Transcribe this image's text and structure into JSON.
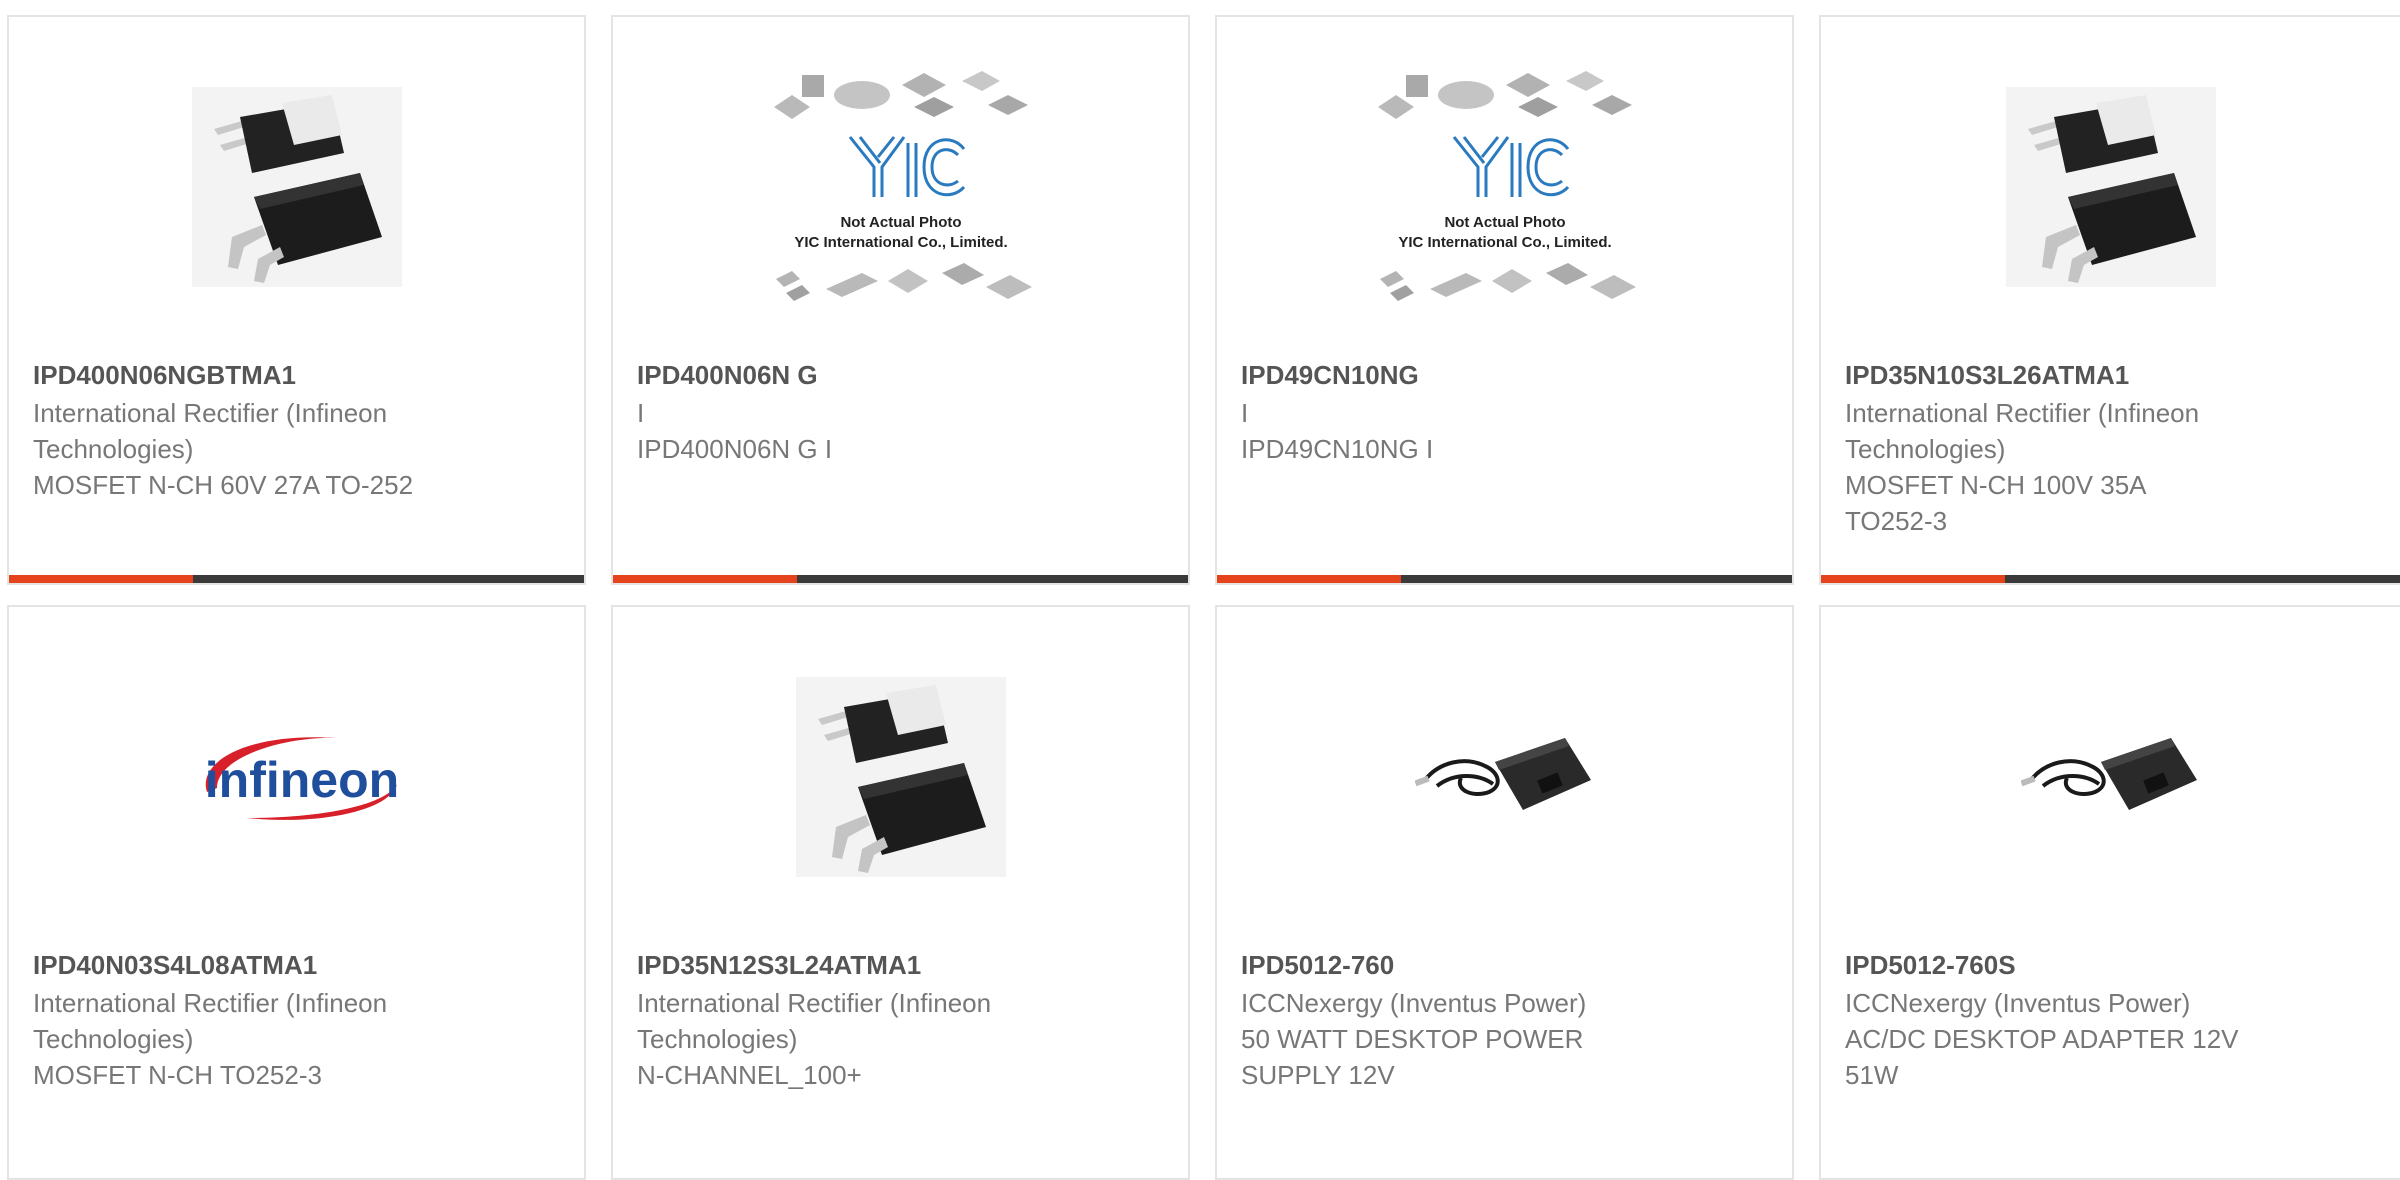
{
  "colors": {
    "accent": "#e5431b",
    "bar": "#3a3a3a",
    "border": "#e4e4e4",
    "part_number": "#555555",
    "text": "#777777"
  },
  "products": [
    {
      "part_number": "IPD400N06NGBTMA1",
      "manufacturer": "International Rectifier (Infineon\nTechnologies)",
      "description": "MOSFET N-CH 60V 27A TO-252",
      "image": "to252-package"
    },
    {
      "part_number": "IPD400N06N G",
      "manufacturer": "I",
      "description": "IPD400N06N G I",
      "image": "yic-placeholder",
      "placeholder_title": "Not Actual Photo",
      "placeholder_sub": "YIC International Co., Limited."
    },
    {
      "part_number": "IPD49CN10NG",
      "manufacturer": "I",
      "description": "IPD49CN10NG I",
      "image": "yic-placeholder",
      "placeholder_title": "Not Actual Photo",
      "placeholder_sub": "YIC International Co., Limited."
    },
    {
      "part_number": "IPD35N10S3L26ATMA1",
      "manufacturer": "International Rectifier (Infineon\nTechnologies)",
      "description": "MOSFET N-CH 100V 35A\nTO252-3",
      "image": "to252-package"
    },
    {
      "part_number": "IPD40N03S4L08ATMA1",
      "manufacturer": "International Rectifier (Infineon\nTechnologies)",
      "description": "MOSFET N-CH TO252-3",
      "image": "infineon-logo",
      "logo_text": "infineon"
    },
    {
      "part_number": "IPD35N12S3L24ATMA1",
      "manufacturer": "International Rectifier (Infineon\nTechnologies)",
      "description": "N-CHANNEL_100+",
      "image": "to252-package"
    },
    {
      "part_number": "IPD5012-760",
      "manufacturer": "ICCNexergy (Inventus Power)",
      "description": "50 WATT DESKTOP POWER\nSUPPLY 12V",
      "image": "power-adapter"
    },
    {
      "part_number": "IPD5012-760S",
      "manufacturer": "ICCNexergy (Inventus Power)",
      "description": "AC/DC DESKTOP ADAPTER 12V\n51W",
      "image": "power-adapter"
    }
  ]
}
